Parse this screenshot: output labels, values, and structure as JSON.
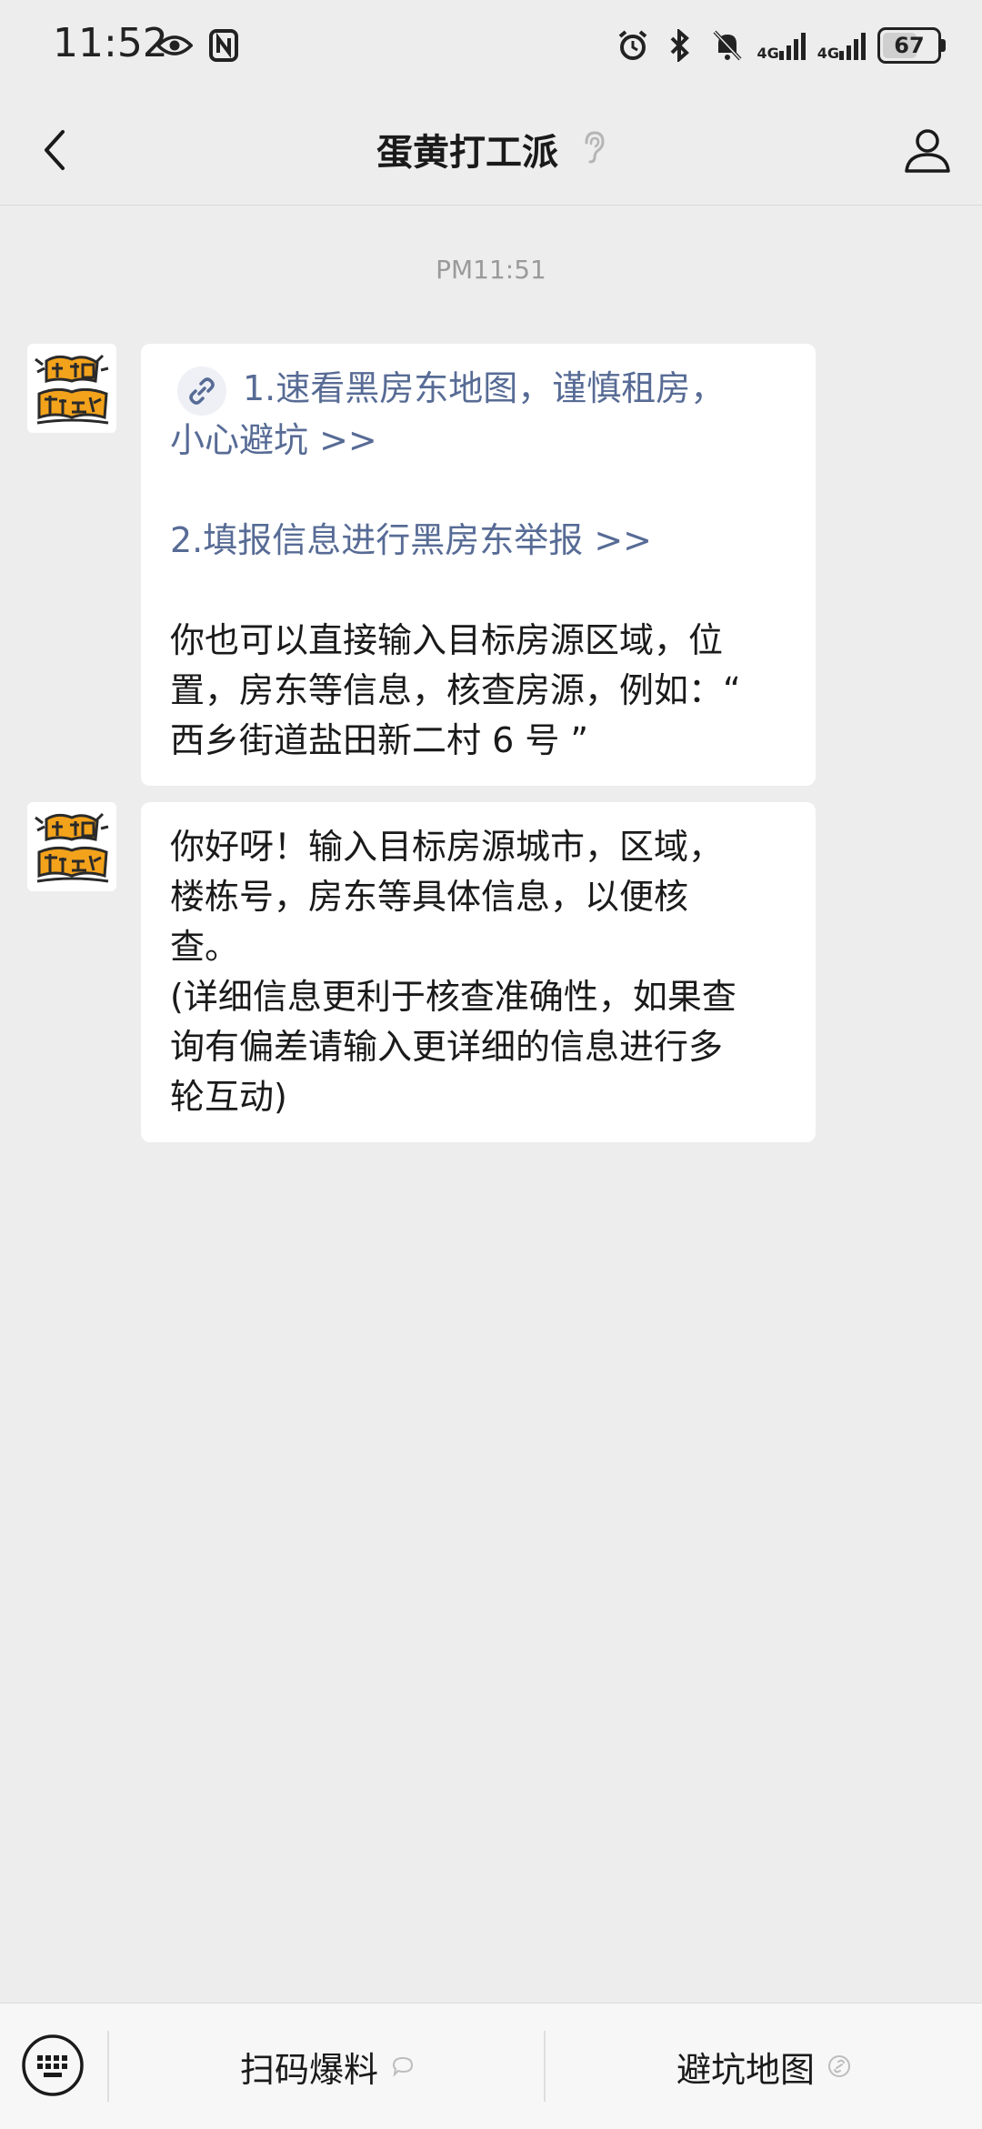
{
  "status_bar": {
    "time": "11:52",
    "network_1": "4G",
    "network_2": "4G",
    "battery_level": "67",
    "battery_fraction": 0.67
  },
  "nav": {
    "title": "蛋黄打工派",
    "back_icon": "chevron-left-icon",
    "ear_icon": "ear-icon",
    "profile_icon": "person-icon"
  },
  "chat": {
    "timestamp": "PM11:51",
    "messages": [
      {
        "avatar_icon": "jiayou-dagongren-sticker",
        "link1_line1": "1.速看黑房东地图，谨慎租房，",
        "link1_line2": "小心避坑 >>",
        "link2": "2.填报信息进行黑房东举报 >>",
        "text_lines": [
          "你也可以直接输入目标房源区域，位",
          "置，房东等信息，核查房源，例如：“",
          "西乡街道盐田新二村 6 号 ”"
        ]
      },
      {
        "avatar_icon": "jiayou-dagongren-sticker",
        "text_lines": [
          "你好呀！输入目标房源城市，区域，",
          "楼栋号，房东等具体信息，以便核",
          "查。",
          "(详细信息更利于核查准确性，如果查",
          "询有偏差请输入更详细的信息进行多",
          "轮互动)"
        ]
      }
    ]
  },
  "bottom_menu": {
    "keyboard_icon": "keyboard-icon",
    "item1_label": "扫码爆料",
    "item2_label": "避坑地图"
  },
  "colors": {
    "background": "#ededed",
    "link": "#576b95",
    "bubble": "#ffffff",
    "avatar_yellow": "#f3a21b"
  }
}
